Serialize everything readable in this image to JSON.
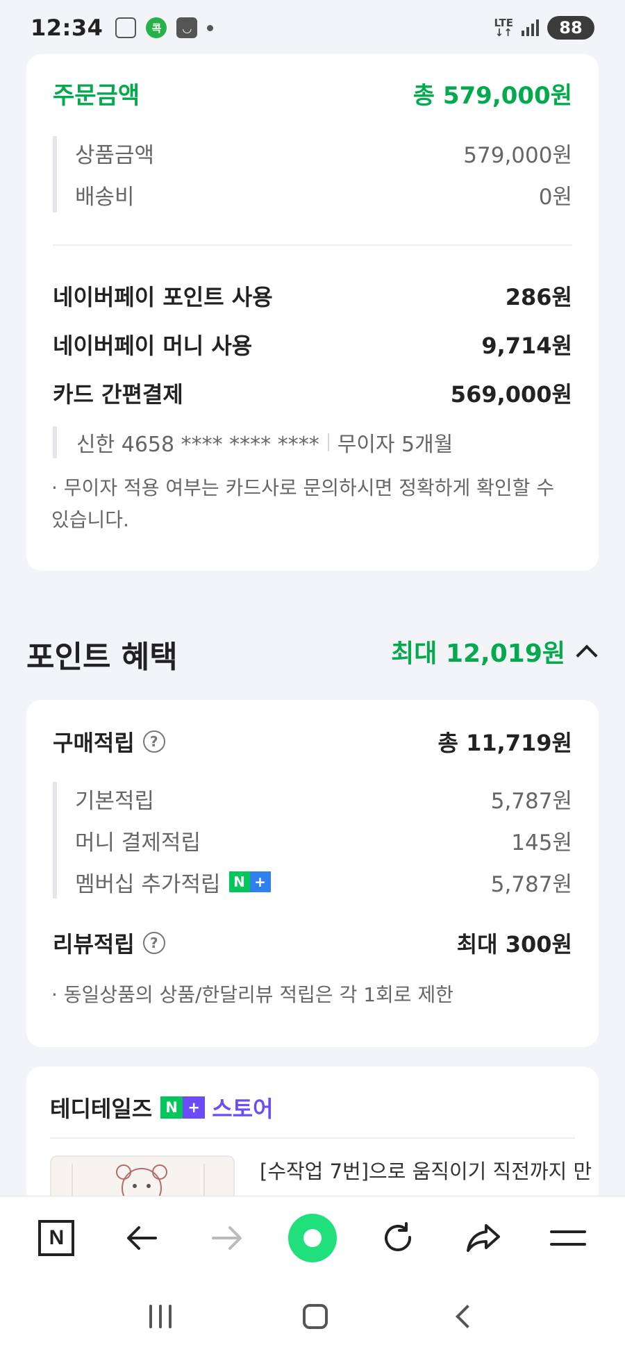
{
  "status_bar": {
    "time": "12:34",
    "app_icon_text": "콕",
    "network": "LTE",
    "battery": "88"
  },
  "order_summary": {
    "title": "주문금액",
    "total": "총 579,000원",
    "items": [
      {
        "label": "상품금액",
        "value": "579,000원"
      },
      {
        "label": "배송비",
        "value": "0원"
      }
    ],
    "payments": [
      {
        "label": "네이버페이 포인트 사용",
        "value": "286원"
      },
      {
        "label": "네이버페이 머니 사용",
        "value": "9,714원"
      },
      {
        "label": "카드 간편결제",
        "value": "569,000원"
      }
    ],
    "card_info": "신한 4658 **** **** ****",
    "installment": "무이자 5개월",
    "note": "· 무이자 적용 여부는 카드사로 문의하시면 정확하게 확인할 수 있습니다."
  },
  "point_benefit": {
    "title": "포인트 혜택",
    "max_amount": "최대 12,019원",
    "purchase": {
      "label": "구매적립",
      "total": "총 11,719원",
      "items": [
        {
          "label": "기본적립",
          "value": "5,787원"
        },
        {
          "label": "머니 결제적립",
          "value": "145원"
        },
        {
          "label": "멤버십 추가적립",
          "value": "5,787원"
        }
      ]
    },
    "review": {
      "label": "리뷰적립",
      "value": "최대 300원",
      "note": "· 동일상품의 상품/한달리뷰 적립은 각 1회로 제한"
    }
  },
  "store": {
    "name": "테디테일즈",
    "badge_n": "N",
    "badge_plus": "+",
    "label": "스토어",
    "product_title": "[수작업 7번]으로 움직이기 직전까지 만"
  },
  "bottom_nav": {
    "n_logo": "N",
    "items": [
      "naver-home",
      "back",
      "forward",
      "green-dot",
      "refresh",
      "share",
      "menu"
    ]
  },
  "colors": {
    "accent_green": "#03a94d",
    "store_purple": "#6c4cf6"
  }
}
